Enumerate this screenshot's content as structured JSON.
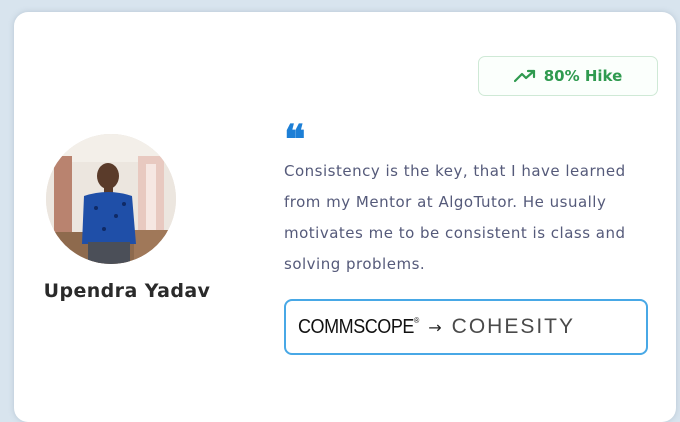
{
  "badge": {
    "label": "80% Hike",
    "icon": "trending-up-icon",
    "color": "#2f9a4f"
  },
  "profile": {
    "name": "Upendra Yadav"
  },
  "testimonial": {
    "quote_icon": "quote-icon",
    "text": "Consistency is the key, that I have learned from my Mentor at AlgoTutor. He usually motivates me to be consistent is class and solving problems."
  },
  "transition": {
    "from_company": "COMMSCOPE",
    "from_mark": "®",
    "arrow": "→",
    "to_company": "COHESITY"
  }
}
